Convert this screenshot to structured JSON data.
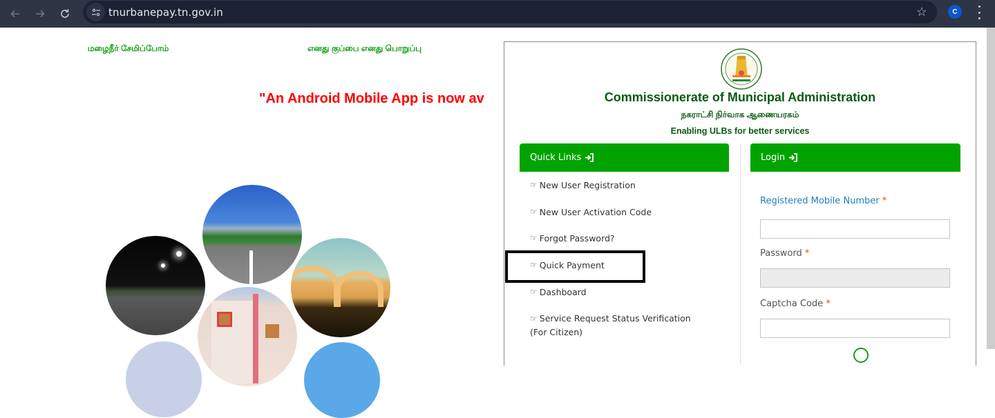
{
  "browser": {
    "url": "tnurbanepay.tn.gov.in",
    "profile_initial": "C",
    "icons": [
      "back-arrow-icon",
      "forward-arrow-icon",
      "reload-icon",
      "site-info-icon",
      "bookmark-star-icon",
      "kebab-menu-icon"
    ]
  },
  "header": {
    "tamil_slogan_1": "மழைநீர் சேமிப்போம்",
    "tamil_slogan_2": "எனது குப்பை எனது பொறுப்பு",
    "marquee_text": "\"An Android Mobile App is now av"
  },
  "organization": {
    "title": "Commissionerate of Municipal Administration",
    "tamil_title": "நகராட்சி நிர்வாக ஆணையரகம்",
    "tagline": "Enabling ULBs for better services",
    "colors": {
      "primary_green": "#00a300",
      "title_green": "#0b5a10",
      "slogan_green": "#0a9a0a",
      "alert_red": "#ff0000",
      "link_blue": "#1f7cc4",
      "required_red": "#e8490f"
    }
  },
  "quick_links": {
    "header": "Quick Links",
    "items": [
      {
        "label": "New User Registration"
      },
      {
        "label": "New User Activation Code"
      },
      {
        "label": "Forgot Password?"
      },
      {
        "label": "Quick Payment"
      },
      {
        "label": "Dashboard"
      },
      {
        "label": "Service Request Status Verification (For Citizen)"
      }
    ]
  },
  "login": {
    "header": "Login",
    "mobile_label": "Registered Mobile Number",
    "mobile_value": "",
    "password_label": "Password",
    "password_value": "",
    "captcha_label": "Captcha Code",
    "captcha_value": "",
    "required_mark": "*"
  }
}
